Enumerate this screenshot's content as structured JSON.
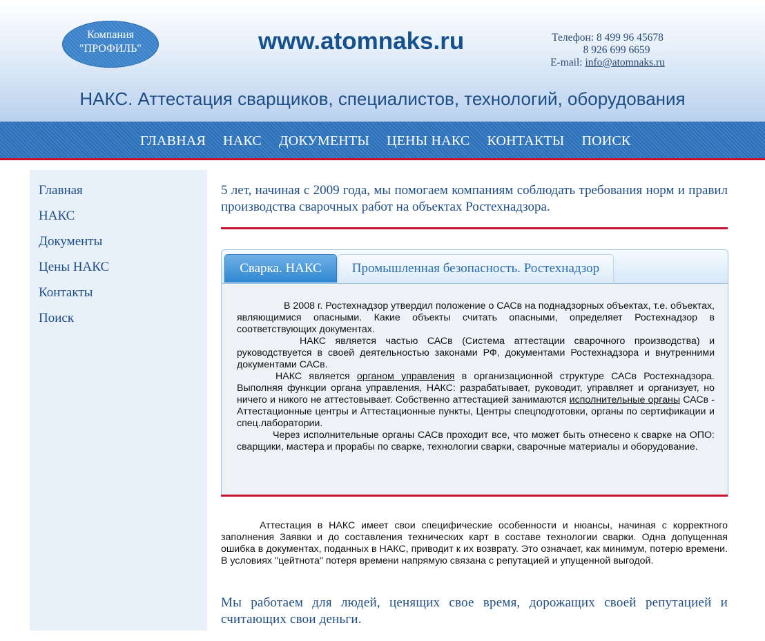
{
  "header": {
    "logo_line1": "Компания",
    "logo_line2": "\"ПРОФИЛЬ\"",
    "site": "www.atomnaks.ru",
    "phone1": "Телефон: 8 499 96 45678",
    "phone2": "8 926 699 6659",
    "email_label": "E-mail:",
    "email": "info@atomnaks.ru",
    "tagline": "НАКС. Аттестация сварщиков, специалистов, технологий, оборудования"
  },
  "nav": [
    "ГЛАВНАЯ",
    "НАКС",
    "ДОКУМЕНТЫ",
    "ЦЕНЫ НАКС",
    "КОНТАКТЫ",
    "ПОИСК"
  ],
  "sidebar": [
    "Главная",
    "НАКС",
    "Документы",
    "Цены НАКС",
    "Контакты",
    "Поиск"
  ],
  "intro": "5 лет, начиная с 2009 года, мы помогаем компаниям соблюдать требования норм и правил производства сварочных работ на объектах Ростехнадзора.",
  "tabs": {
    "active": "Сварка. НАКС",
    "inactive": "Промышленная безопасность. Ростехнадзор",
    "p1": "В 2008 г. Ростехнадзор утвердил положение о САСв на поднадзорных объектах, т.е. объектах, являющимися опасными. Какие объекты считать опасными, определяет Ростехнадзор в соответствующих документах.",
    "p2": "НАКС является частью САСв (Система аттестации сварочного производства) и руководствуется в своей деятельностью законами РФ, документами Ростехнадзора и внутренними документами САСв.",
    "p3_a": "НАКС является ",
    "p3_link1": "органом управления",
    "p3_b": " в организационной структуре САСв Ростехнадзора. Выполняя функции органа управления, НАКС: разрабатывает, руководит, управляет и организует, но ничего и никого не аттестовывает. Собственно аттестацией занимаются ",
    "p3_link2": "исполнительные органы",
    "p3_c": " САСв - Аттестационные центры и Аттестационные пункты, Центры спецподготовки, органы по сертификации и спец.лаборатории.",
    "p4": "Через исполнительные органы САСв проходит все, что может быть отнесено к сварке на ОПО: сварщики, мастера и прорабы по сварке, технологии сварки, сварочные материалы и оборудование."
  },
  "para2": "Аттестация в НАКС имеет свои специфические особенности и нюансы, начиная с корректного заполнения Заявки и до составления технических карт в составе технологии сварки. Одна допущенная ошибка в документах, поданных в НАКС, приводит к их возврату. Это означает, как минимум, потерю времени. В условиях \"цейтнота\" потеря времени напрямую связана с репутацией и упущенной выгодой.",
  "closing": "Мы работаем для людей, ценящих свое время, дорожащих своей репутацией и считающих свои деньги."
}
